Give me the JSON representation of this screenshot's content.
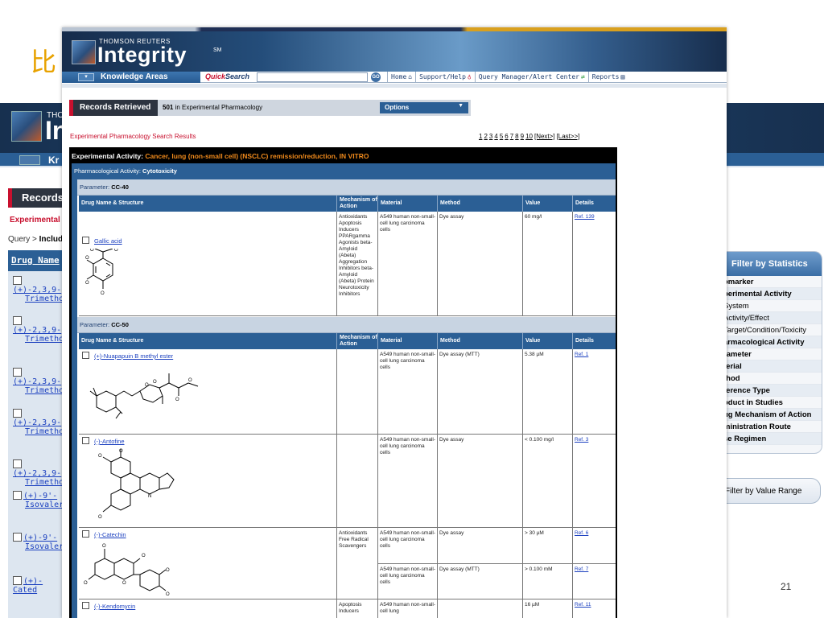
{
  "slide": {
    "title": "比",
    "page_number": "21"
  },
  "background_window": {
    "logo_small": "THO",
    "logo_big": "In",
    "knowledge_label": "Kr",
    "records_label": "Records",
    "experimental_label": "Experimental I",
    "query_prefix": "Query > ",
    "query_bold": "Include",
    "column_header": "Drug Name",
    "rows": [
      {
        "l1": "(+)-2,3,9-",
        "l2": "Trimethox"
      },
      {
        "l1": "(+)-2,3,9-",
        "l2": "Trimethox"
      },
      {
        "l1": "(+)-2,3,9-",
        "l2": "Trimethox"
      },
      {
        "l1": "(+)-2,3,9-",
        "l2": "Trimethox"
      },
      {
        "l1": "(+)-2,3,9-",
        "l2": "Trimethox"
      },
      {
        "l1": "(+)-9'-",
        "l2": "Isovalero"
      },
      {
        "l1": "(+)-9'-",
        "l2": "Isovalero"
      },
      {
        "l1": "(+)-Cated",
        "l2": ""
      }
    ]
  },
  "filter_panel": {
    "title": "Filter by Statistics",
    "items": [
      "omarker",
      "perimental Activity",
      "System",
      "Activity/Effect",
      "Target/Condition/Toxicity",
      "armacological Activity",
      "rameter",
      "terial",
      "thod",
      "ference Type",
      "oduct in Studies",
      "ug Mechanism of Action",
      "ministration Route",
      "se Regimen"
    ],
    "value_range": "Filter by Value Range"
  },
  "app": {
    "logo_small": "THOMSON REUTERS",
    "logo_big": "Integrity",
    "logo_mark": "SM",
    "knowledge_areas": "Knowledge Areas",
    "quick": "Quick",
    "search": "Search",
    "go": "GO",
    "nav_links": [
      "Home",
      "Support/Help",
      "Query Manager/Alert Center",
      "Reports"
    ]
  },
  "records": {
    "title": "Records Retrieved",
    "count": "501",
    "count_suffix": " in Experimental Pharmacology",
    "options": "Options"
  },
  "results_title": "Experimental Pharmacology Search Results",
  "pager": [
    "1",
    "2",
    "3",
    "4",
    "5",
    "6",
    "7",
    "8",
    "9",
    "10",
    "[Next>]",
    "[Last>>]"
  ],
  "activity": {
    "label": "Experimental Activity: ",
    "value": "Cancer, lung (non-small cell) (NSCLC) remission/reduction, IN VITRO",
    "pharma_label": "Pharmacological Activity: ",
    "pharma_value": "Cytotoxicity"
  },
  "table_headers": {
    "drug": "Drug Name & Structure",
    "mechanism": "Mechanism of Action",
    "material": "Material",
    "method": "Method",
    "value": "Value",
    "details": "Details"
  },
  "parameters": [
    {
      "label": "Parameter: ",
      "value": "CC-40"
    },
    {
      "label": "Parameter: ",
      "value": "CC-50"
    }
  ],
  "rows": [
    {
      "drug": "Gallic acid",
      "mechanism": "Antioxidants Apoptosis Inducers PPARgamma Agonists beta-Amyloid (Abeta) Aggregation Inhibitors beta-Amyloid (Abeta) Protein Neurotoxicity Inhibitors",
      "material": "A549 human non-small-cell lung carcinoma cells",
      "method": "Dye assay",
      "value": "60 mg/l",
      "details": "Ref. 139"
    },
    {
      "drug": "(+)-Nuapapuin B methyl ester",
      "mechanism": "",
      "material": "A549 human non-small-cell lung carcinoma cells",
      "method": "Dye assay (MTT)",
      "value": "5.38 µM",
      "details": "Ref. 1"
    },
    {
      "drug": "(-)-Antofine",
      "mechanism": "",
      "material": "A549 human non-small-cell lung carcinoma cells",
      "method": "Dye assay",
      "value": "< 0.100 mg/l",
      "details": "Ref. 3"
    },
    {
      "drug": "(-)-Catechin",
      "mechanism": "Antioxidants Free Radical Scavengers",
      "material": "A549 human non-small-cell lung carcinoma cells",
      "method": "Dye assay",
      "value": "> 30 µM",
      "details": "Ref. 6",
      "material2": "A549 human non-small-cell lung carcinoma cells",
      "method2": "Dye assay (MTT)",
      "value2": "> 0.100 mM",
      "details2": "Ref. 7"
    },
    {
      "drug": "(-)-Kendomycin",
      "mechanism": "Apoptosis Inducers",
      "material": "A549 human non-small-cell lung",
      "method": "",
      "value": "16 µM",
      "details": "Ref. 11"
    }
  ],
  "colors": {
    "navy": "#2b5f95",
    "accent_red": "#c8102e",
    "accent_orange": "#f08a1c",
    "link": "#1a3fbf"
  }
}
